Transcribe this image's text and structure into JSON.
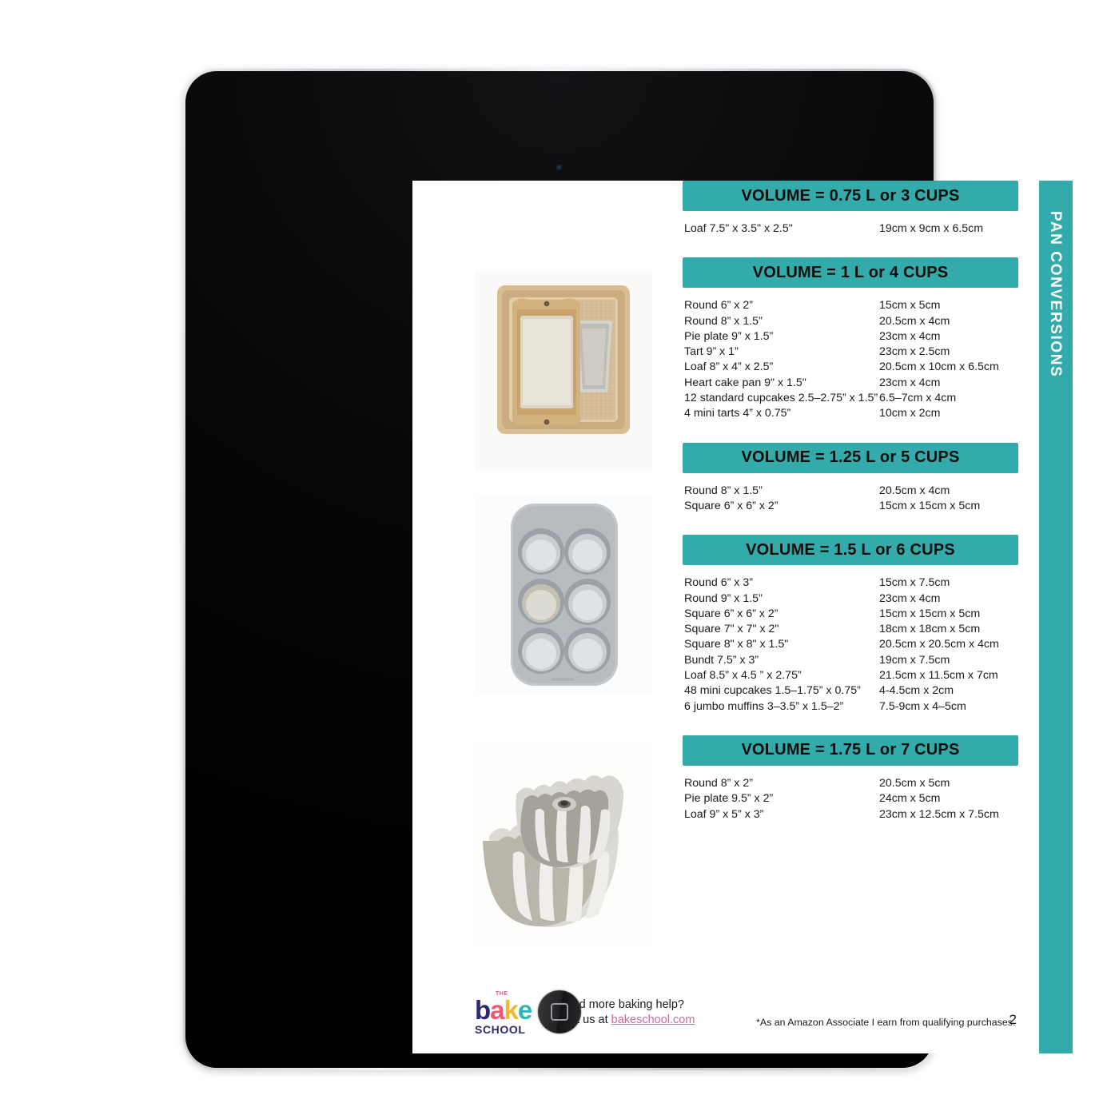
{
  "device": {
    "type": "tablet",
    "home_button": "home-button"
  },
  "sidebar": {
    "label": "PAN CONVERSIONS"
  },
  "colors": {
    "teal": "#33abaa",
    "text": "#1b1b1b",
    "link": "#c46ca0"
  },
  "photos": [
    {
      "name": "gold-loaf-pans-photo",
      "alt": "Gold loaf pans in a square baking tray"
    },
    {
      "name": "muffin-tin-photo",
      "alt": "Silver six-cup muffin tin"
    },
    {
      "name": "bundt-pans-photo",
      "alt": "Two stacked fluted bundt pans"
    }
  ],
  "sections": [
    {
      "heading": "VOLUME = 0.75 L or 3 CUPS",
      "rows": [
        {
          "imperial": "Loaf 7.5\" x 3.5\" x 2.5\"",
          "metric": "19cm x 9cm x 6.5cm"
        }
      ]
    },
    {
      "heading": "VOLUME = 1 L or 4 CUPS",
      "rows": [
        {
          "imperial": "Round 6” x 2”",
          "metric": "15cm x 5cm"
        },
        {
          "imperial": "Round 8” x 1.5”",
          "metric": "20.5cm x 4cm"
        },
        {
          "imperial": "Pie plate 9” x 1.5”",
          "metric": "23cm x 4cm"
        },
        {
          "imperial": "Tart 9” x 1”",
          "metric": "23cm x 2.5cm"
        },
        {
          "imperial": "Loaf 8” x 4” x 2.5”",
          "metric": "20.5cm x 10cm x 6.5cm"
        },
        {
          "imperial": "Heart cake pan 9\" x 1.5\"",
          "metric": "23cm x 4cm"
        },
        {
          "imperial": "12 standard cupcakes 2.5–2.75” x 1.5”",
          "metric": "6.5–7cm x 4cm"
        },
        {
          "imperial": "4 mini tarts 4” x 0.75”",
          "metric": "10cm x 2cm"
        }
      ]
    },
    {
      "heading": "VOLUME = 1.25 L or 5 CUPS",
      "rows": [
        {
          "imperial": "Round 8” x 1.5”",
          "metric": "20.5cm x 4cm"
        },
        {
          "imperial": "Square 6” x 6” x 2”",
          "metric": "15cm x 15cm x 5cm"
        }
      ]
    },
    {
      "heading": "VOLUME = 1.5 L or 6 CUPS",
      "rows": [
        {
          "imperial": "Round 6” x 3”",
          "metric": "15cm x 7.5cm"
        },
        {
          "imperial": "Round 9” x 1.5”",
          "metric": "23cm x 4cm"
        },
        {
          "imperial": "Square 6” x 6” x 2”",
          "metric": "15cm x 15cm x 5cm"
        },
        {
          "imperial": "Square 7\" x 7\" x 2\"",
          "metric": "18cm x 18cm x 5cm"
        },
        {
          "imperial": "Square 8\" x 8\" x 1.5\"",
          "metric": "20.5cm x 20.5cm x 4cm"
        },
        {
          "imperial": "Bundt 7.5” x 3”",
          "metric": "19cm x 7.5cm"
        },
        {
          "imperial": "Loaf 8.5” x 4.5 ” x 2.75”",
          "metric": "21.5cm x 11.5cm x 7cm"
        },
        {
          "imperial": "48 mini cupcakes 1.5–1.75” x 0.75”",
          "metric": "4-4.5cm x 2cm"
        },
        {
          "imperial": "6 jumbo muffins 3–3.5” x 1.5–2”",
          "metric": "7.5-9cm x 4–5cm"
        }
      ]
    },
    {
      "heading": "VOLUME = 1.75 L or 7 CUPS",
      "rows": [
        {
          "imperial": "Round 8” x 2”",
          "metric": "20.5cm x 5cm"
        },
        {
          "imperial": "Pie plate 9.5” x 2”",
          "metric": "24cm x 5cm"
        },
        {
          "imperial": "Loaf 9” x 5” x 3”",
          "metric": "23cm x 12.5cm x 7.5cm"
        }
      ]
    }
  ],
  "footer": {
    "logo": {
      "the": "THE",
      "b": "b",
      "a": "a",
      "k": "k",
      "e": "e",
      "school": "SCHOOL"
    },
    "help_line1": "Need more baking help?",
    "help_line2_prefix": "Visit us at ",
    "help_link": "bakeschool.com",
    "disclaimer": "*As an Amazon Associate I earn from qualifying purchases.",
    "page_number": "2"
  }
}
